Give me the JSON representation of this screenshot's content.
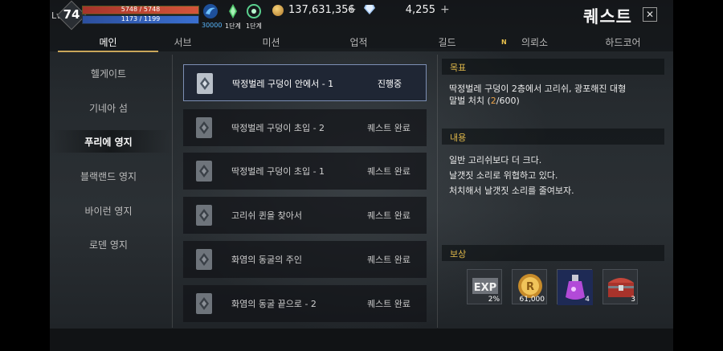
{
  "player": {
    "level_label": "Lv",
    "level": "74",
    "hp": "5748 / 5748",
    "hp_fraction": 1.0,
    "mp": "1173 / 1199",
    "mp_fraction": 0.978
  },
  "skills": [
    {
      "icon": "blue-swirl-icon",
      "caption": "30000"
    },
    {
      "icon": "green-crystal-icon",
      "caption": "1단계"
    },
    {
      "icon": "green-emblem-icon",
      "caption": "1단계"
    }
  ],
  "currency": {
    "gold": "137,631,356",
    "gems": "4,255"
  },
  "window": {
    "title": "퀘스트",
    "close": "✕"
  },
  "tabs": [
    {
      "label": "메인",
      "active": true
    },
    {
      "label": "서브"
    },
    {
      "label": "미션"
    },
    {
      "label": "업적"
    },
    {
      "label": "길드"
    },
    {
      "label": "의뢰소",
      "badge": "N"
    },
    {
      "label": "하드코어"
    }
  ],
  "regions": [
    {
      "label": "헬게이트"
    },
    {
      "label": "기네아 섬"
    },
    {
      "label": "푸리에 영지",
      "active": true
    },
    {
      "label": "블랙랜드 영지"
    },
    {
      "label": "바이런 영지"
    },
    {
      "label": "로덴 영지"
    }
  ],
  "quests": [
    {
      "name": "딱정벌레 구덩이 안에서 - 1",
      "status": "진행중",
      "active": true
    },
    {
      "name": "딱정벌레 구덩이 초입 - 2",
      "status": "퀘스트 완료"
    },
    {
      "name": "딱정벌레 구덩이 초입 - 1",
      "status": "퀘스트 완료"
    },
    {
      "name": "고리쉬 퀸을 찾아서",
      "status": "퀘스트 완료"
    },
    {
      "name": "화염의 동굴의 주인",
      "status": "퀘스트 완료"
    },
    {
      "name": "화염의 동굴 끝으로 - 2",
      "status": "퀘스트 완료"
    }
  ],
  "detail": {
    "goal_header": "목표",
    "goal_line1": "딱정벌레 구덩이 2층에서 고리쉬, 광포해진 대형",
    "goal_line2_prefix": "말벌 처치 (",
    "goal_progress": "2",
    "goal_line2_suffix": "/600)",
    "content_header": "내용",
    "content_lines": [
      "일반 고리쉬보다 더 크다.",
      "날갯짓 소리로 위협하고 있다.",
      "처치해서 날갯짓 소리를 줄여보자."
    ],
    "reward_header": "보상",
    "rewards": [
      {
        "icon": "exp-icon",
        "label": "EXP",
        "qty": "2%"
      },
      {
        "icon": "gold-coin-icon",
        "label": "R",
        "qty": "61,000"
      },
      {
        "icon": "potion-icon",
        "qty": "4"
      },
      {
        "icon": "treasure-chest-icon",
        "qty": "3"
      }
    ]
  },
  "colors": {
    "accent": "#e0b84a",
    "progress": "#e8a24a",
    "active_border": "#7d8fb4"
  }
}
